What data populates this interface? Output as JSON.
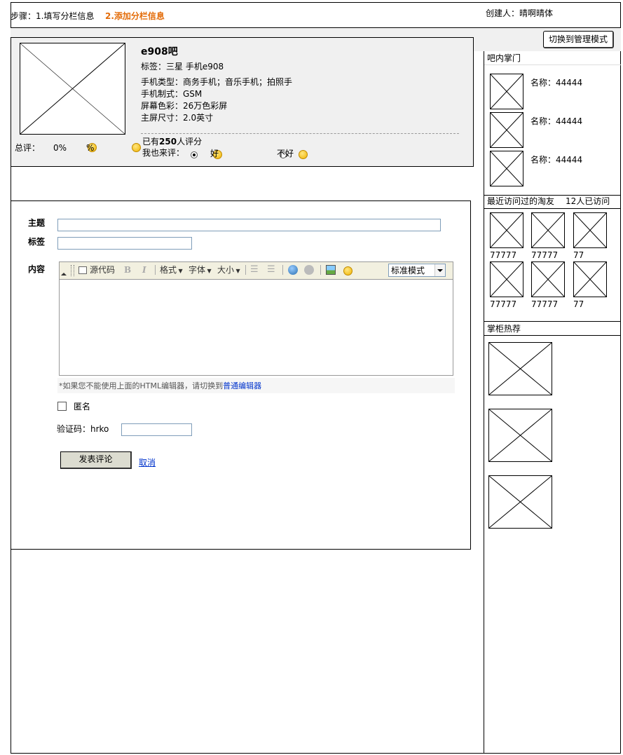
{
  "header": {
    "steps_label": "步骤：1.填写分栏信息",
    "step2_label": "2.添加分栏信息",
    "creator_label": "创建人：晴啊晴体"
  },
  "admin_button": "切换到管理模式",
  "info": {
    "name": "e908吧",
    "tags": "标签：三星  手机e908",
    "phone_type": "手机类型：商务手机；音乐手机；拍照手",
    "standard": "手机制式：GSM",
    "screen_color": "屏幕色彩：26万色彩屏",
    "screen_size": "主屏尺寸：2.0英寸",
    "rating_prefix": "已有",
    "rating_count": "250",
    "rating_suffix": "人评分",
    "rate_label": "我也来评：",
    "good_label": "好",
    "bad_label": "不好",
    "total_label": "总评：",
    "good_percent": "0%",
    "bad_percent": "%"
  },
  "form": {
    "subject_label": "主题",
    "tags_label": "标签",
    "content_label": "内容",
    "subject_value": "",
    "tags_value": "",
    "toolbar": {
      "source": "源代码",
      "bold": "B",
      "italic": "I",
      "format": "格式",
      "font": "字体",
      "size": "大小",
      "mode": "标准模式"
    },
    "editor_note": "*如果您不能使用上面的HTML编辑器，请切换到",
    "editor_link": "普通编辑器",
    "anonymous_label": "匿名",
    "captcha_label": "验证码：hrko",
    "captcha_value": "",
    "submit": "发表评论",
    "cancel": "取消"
  },
  "sidebar": {
    "managers_title": "吧内掌门",
    "managers": [
      {
        "name": "名称：44444"
      },
      {
        "name": "名称：44444"
      },
      {
        "name": "名称：44444"
      }
    ],
    "visitors_title": "最近访问过的淘友",
    "visitors_count": "12人已访问",
    "visitors": [
      {
        "name": "77777"
      },
      {
        "name": "77777"
      },
      {
        "name": "77"
      },
      {
        "name": "77777"
      },
      {
        "name": "77777"
      },
      {
        "name": "77"
      }
    ],
    "recommend_title": "掌柜热荐"
  },
  "colors": {
    "accent_orange": "#e36c09",
    "link_blue": "#0033cc",
    "info_bg": "#f0f0f0",
    "toolbar_bg": "#f2f0e0"
  }
}
